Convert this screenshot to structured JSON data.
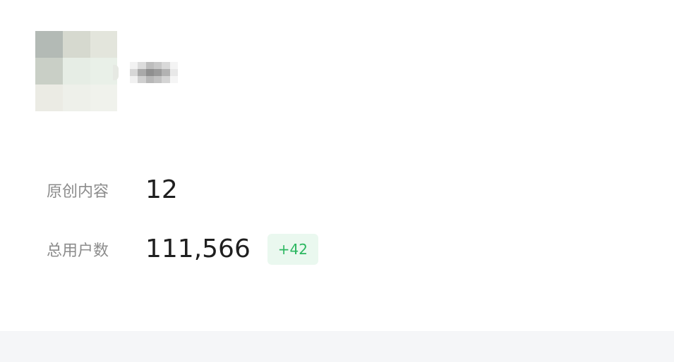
{
  "profile": {
    "avatar_pixels": [
      "#b3bab5",
      "#d6d9cf",
      "#e3e5dc",
      "#c9cfc6",
      "#e6ede5",
      "#e9f0e8",
      "#ebebe4",
      "#eef0ea",
      "#f0f2ec"
    ],
    "nickname_pixels": [
      "#f2f2f2",
      "#dcdcdc",
      "#bdbdbd",
      "#c8c8c8",
      "#d9d9d9",
      "#f4f4f4",
      "#d7d7d7",
      "#a9a9a9",
      "#8f8f8f",
      "#9a9a9a",
      "#b2b2b2",
      "#e8e8e8",
      "#f1f1f1",
      "#cfcfcf",
      "#b7b7b7",
      "#c2c2c2",
      "#d4d4d4",
      "#f5f5f5"
    ]
  },
  "stats": {
    "original_content": {
      "label": "原创内容",
      "value": "12"
    },
    "total_users": {
      "label": "总用户数",
      "value": "111,566",
      "delta": "+42"
    }
  },
  "colors": {
    "label": "#8c8c8c",
    "value": "#1f1f1f",
    "delta_text": "#2bb760",
    "delta_bg": "#eaf8ef",
    "footer_bg": "#f5f6f8"
  }
}
